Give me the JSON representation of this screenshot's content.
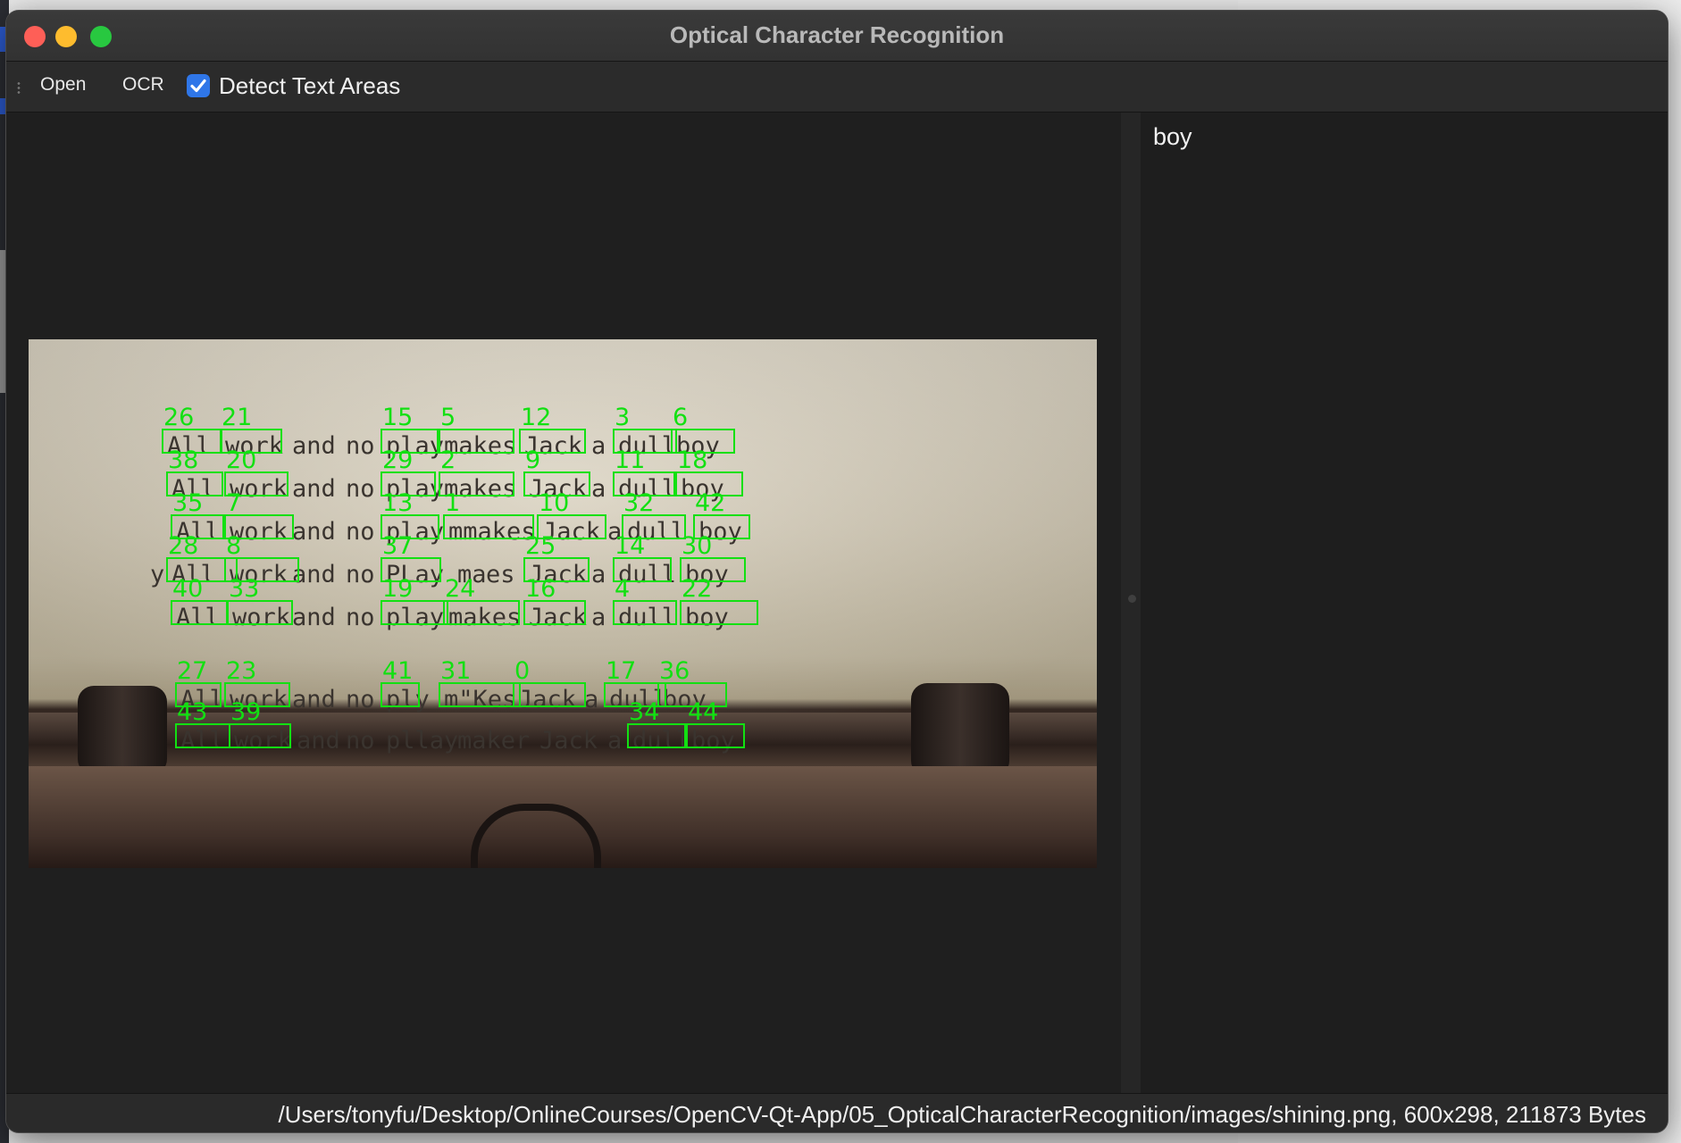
{
  "window": {
    "title": "Optical Character Recognition"
  },
  "toolbar": {
    "open_label": "Open",
    "ocr_label": "OCR",
    "detect_label": "Detect Text Areas",
    "detect_checked": true
  },
  "ocr_output": {
    "text": "boy"
  },
  "status": {
    "text": "/Users/tonyfu/Desktop/OnlineCourses/OpenCV-Qt-App/05_OpticalCharacterRecognition/images/shining.png, 600x298, 211873 Bytes"
  },
  "image": {
    "lines": [
      [
        "All",
        "work",
        "and",
        "no",
        "play",
        "makes",
        "Jack",
        "a",
        "dull",
        "boy"
      ],
      [
        "All",
        "work",
        "and",
        "no",
        "play",
        "makes",
        "Jack",
        "a",
        "dull",
        "boy"
      ],
      [
        "All",
        "work",
        "and",
        "no",
        "play",
        "mmakes",
        "Jack",
        "a",
        "dull",
        "boy"
      ],
      [
        "y",
        "All",
        "work",
        "and",
        "no",
        "PLay",
        "ma",
        "es",
        "Jack",
        "a",
        "dull",
        "boy"
      ],
      [
        "All",
        "work",
        "and",
        "no",
        "play",
        "makes",
        "Jack",
        "a",
        "dull",
        "boy"
      ],
      [
        "All",
        "work",
        "and",
        "no",
        "ply",
        "m\"Kes",
        "Jack",
        "a",
        "dull",
        "boy"
      ],
      [
        "All",
        "work",
        "and",
        "no",
        "pllay",
        "maker",
        "Jack",
        "a",
        "dull",
        "boy"
      ]
    ],
    "box_numbers": [
      "26",
      "21",
      "15",
      "5",
      "12",
      "3",
      "6",
      "38",
      "20",
      "29",
      "2",
      "9",
      "11",
      "18",
      "35",
      "7",
      "13",
      "1",
      "10",
      "32",
      "42",
      "28",
      "8",
      "37",
      "25",
      "14",
      "30",
      "40",
      "33",
      "19",
      "24",
      "16",
      "4",
      "22",
      "27",
      "23",
      "41",
      "31",
      "0",
      "17",
      "36",
      "43",
      "39",
      "34",
      "44"
    ]
  },
  "colors": {
    "box_outline": "#12e012",
    "checkbox_accent": "#2f76e8"
  }
}
